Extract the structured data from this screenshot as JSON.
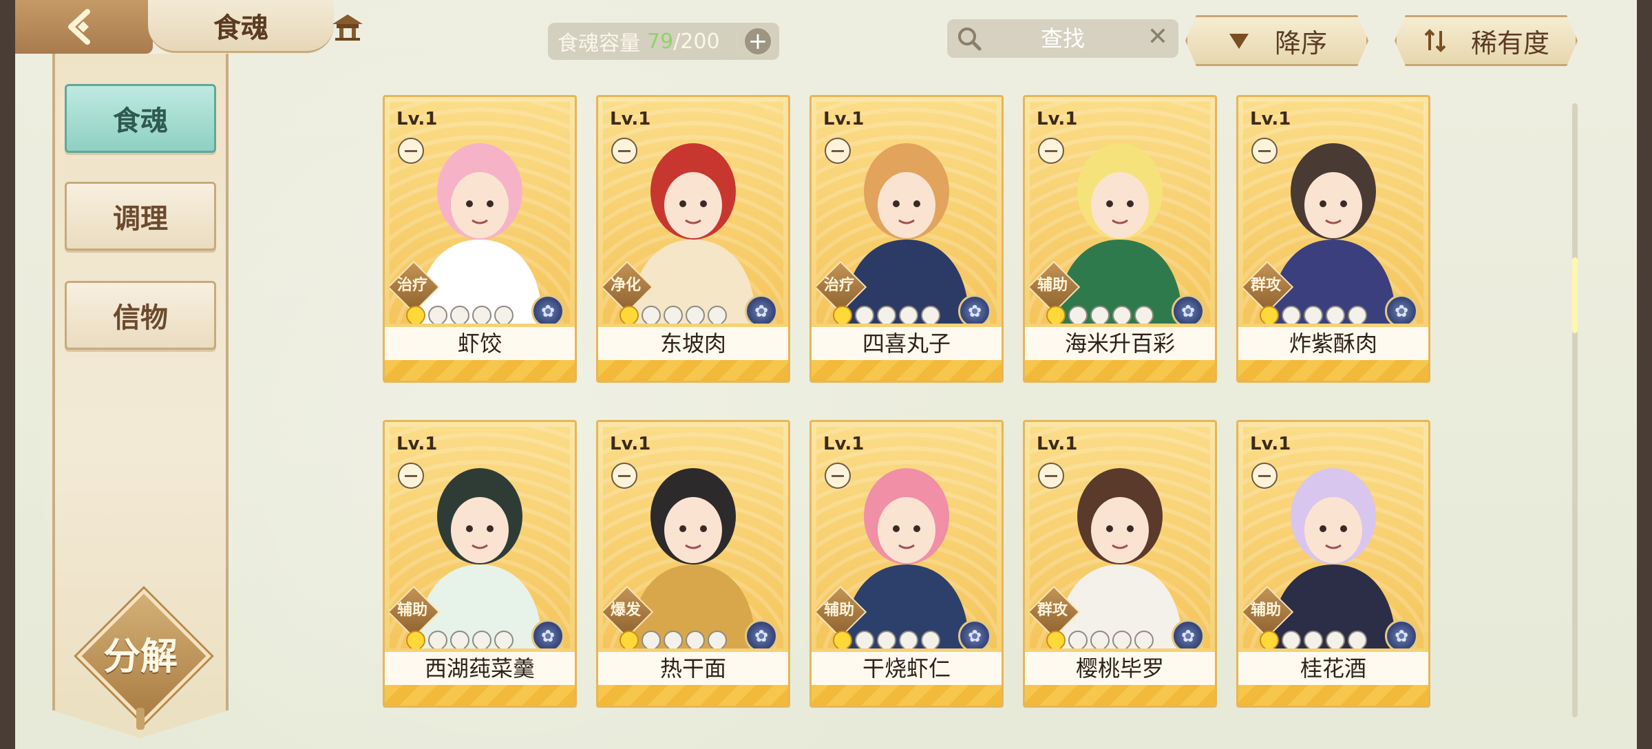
{
  "header": {
    "title": "食魂",
    "capacity_label": "食魂容量",
    "capacity_current": "79",
    "capacity_separator": "/",
    "capacity_max": "200",
    "search_placeholder": "查找",
    "sort_order_label": "降序",
    "sort_key_label": "稀有度"
  },
  "sidebar": {
    "tabs": [
      {
        "label": "食魂",
        "active": true
      },
      {
        "label": "调理",
        "active": false
      },
      {
        "label": "信物",
        "active": false
      }
    ],
    "decompose_label": "分解"
  },
  "cards": [
    {
      "level": "Lv.1",
      "name": "虾饺",
      "role": "治疗",
      "stars_lit": 1,
      "stars_total": 5
    },
    {
      "level": "Lv.1",
      "name": "东坡肉",
      "role": "净化",
      "stars_lit": 1,
      "stars_total": 5
    },
    {
      "level": "Lv.1",
      "name": "四喜丸子",
      "role": "治疗",
      "stars_lit": 1,
      "stars_total": 5
    },
    {
      "level": "Lv.1",
      "name": "海米升百彩",
      "role": "辅助",
      "stars_lit": 1,
      "stars_total": 5
    },
    {
      "level": "Lv.1",
      "name": "炸紫酥肉",
      "role": "群攻",
      "stars_lit": 1,
      "stars_total": 5
    },
    {
      "level": "Lv.1",
      "name": "西湖莼菜羹",
      "role": "辅助",
      "stars_lit": 1,
      "stars_total": 5
    },
    {
      "level": "Lv.1",
      "name": "热干面",
      "role": "爆发",
      "stars_lit": 1,
      "stars_total": 5
    },
    {
      "level": "Lv.1",
      "name": "干烧虾仁",
      "role": "辅助",
      "stars_lit": 1,
      "stars_total": 5
    },
    {
      "level": "Lv.1",
      "name": "樱桃毕罗",
      "role": "群攻",
      "stars_lit": 1,
      "stars_total": 5
    },
    {
      "level": "Lv.1",
      "name": "桂花酒",
      "role": "辅助",
      "stars_lit": 1,
      "stars_total": 5
    }
  ],
  "colors": {
    "capacity_current": "#8fd36b",
    "active_tab": "#8ed0c2",
    "card_gold": "#f4cd6a",
    "star_lit": "#ffd93a"
  },
  "icons": {
    "back": "back-arrow-icon",
    "home": "home-pavilion-icon",
    "search": "search-icon",
    "clear": "close-icon",
    "sort_order": "triangle-down-icon",
    "sort_key": "sort-arrows-icon"
  }
}
